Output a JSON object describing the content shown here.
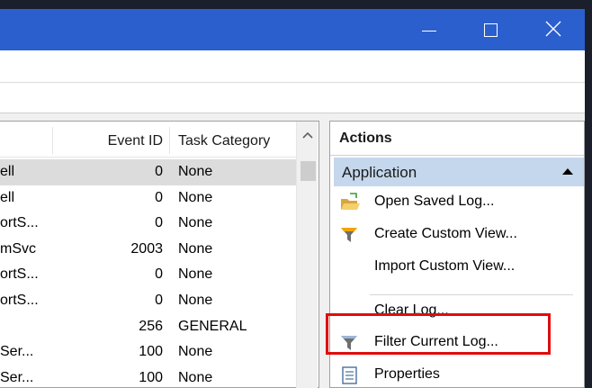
{
  "colors": {
    "titlebar": "#2b5fce",
    "selection": "#dcdcdc",
    "section_header": "#c5d7ec",
    "highlight": "#e00d0d"
  },
  "window_controls": {
    "minimize_icon": "minimize-icon",
    "maximize_icon": "maximize-icon",
    "close_icon": "close-icon"
  },
  "events": {
    "columns": [
      "Event ID",
      "Task Category"
    ],
    "rows": [
      {
        "source": "ell",
        "event_id": "0",
        "category": "None",
        "selected": true
      },
      {
        "source": "ell",
        "event_id": "0",
        "category": "None"
      },
      {
        "source": "ortS...",
        "event_id": "0",
        "category": "None"
      },
      {
        "source": "mSvc",
        "event_id": "2003",
        "category": "None"
      },
      {
        "source": "ortS...",
        "event_id": "0",
        "category": "None"
      },
      {
        "source": "ortS...",
        "event_id": "0",
        "category": "None"
      },
      {
        "source": "",
        "event_id": "256",
        "category": "GENERAL"
      },
      {
        "source": "Ser...",
        "event_id": "100",
        "category": "None"
      },
      {
        "source": "Ser...",
        "event_id": "100",
        "category": "None"
      }
    ]
  },
  "actions": {
    "title": "Actions",
    "section": "Application",
    "items": [
      {
        "label": "Open Saved Log...",
        "icon": "folder-open-icon"
      },
      {
        "label": "Create Custom View...",
        "icon": "filter-icon"
      },
      {
        "label": "Import Custom View...",
        "icon": ""
      },
      {
        "label": "Clear Log...",
        "icon": ""
      },
      {
        "label": "Filter Current Log...",
        "icon": "filter-icon"
      },
      {
        "label": "Properties",
        "icon": "properties-icon"
      }
    ]
  }
}
